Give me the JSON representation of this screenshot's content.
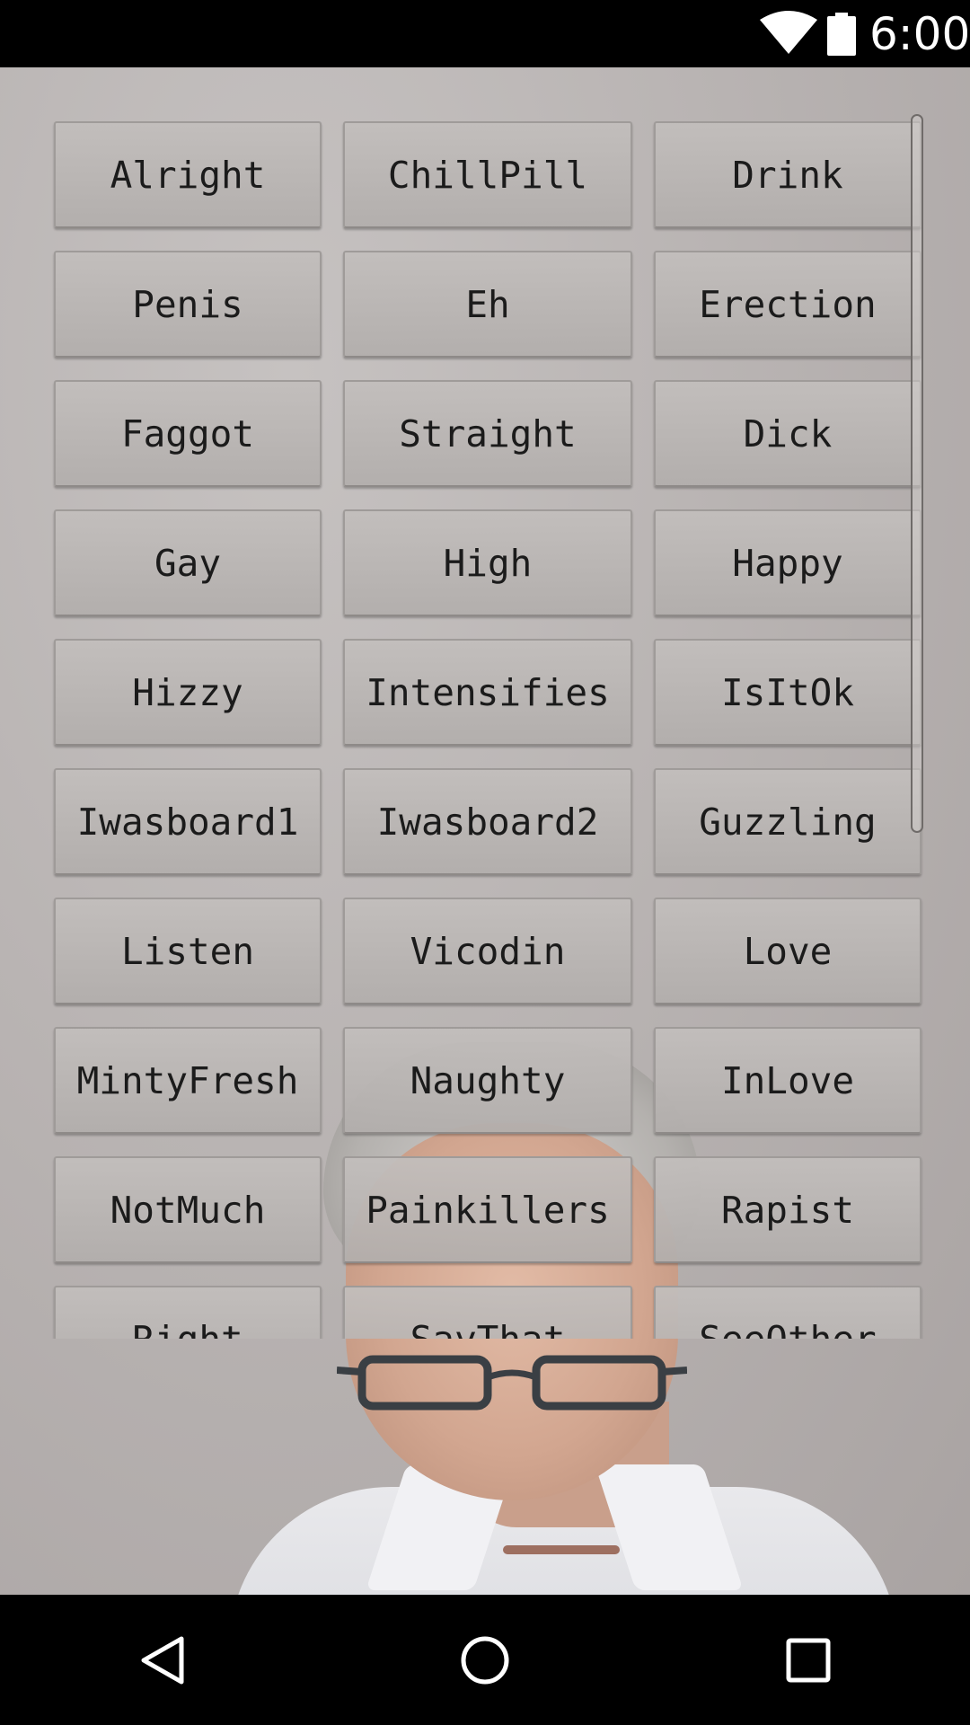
{
  "status_bar": {
    "time": "6:00",
    "icons": [
      "wifi-icon",
      "battery-icon"
    ]
  },
  "buttons": [
    {
      "label": "Alright"
    },
    {
      "label": "ChillPill"
    },
    {
      "label": "Drink"
    },
    {
      "label": "Penis"
    },
    {
      "label": "Eh"
    },
    {
      "label": "Erection"
    },
    {
      "label": "Faggot"
    },
    {
      "label": "Straight"
    },
    {
      "label": "Dick"
    },
    {
      "label": "Gay"
    },
    {
      "label": "High"
    },
    {
      "label": "Happy"
    },
    {
      "label": "Hizzy"
    },
    {
      "label": "Intensifies"
    },
    {
      "label": "IsItOk"
    },
    {
      "label": "Iwasboard1"
    },
    {
      "label": "Iwasboard2"
    },
    {
      "label": "Guzzling"
    },
    {
      "label": "Listen"
    },
    {
      "label": "Vicodin"
    },
    {
      "label": "Love"
    },
    {
      "label": "MintyFresh"
    },
    {
      "label": "Naughty"
    },
    {
      "label": "InLove"
    },
    {
      "label": "NotMuch"
    },
    {
      "label": "Painkillers"
    },
    {
      "label": "Rapist"
    },
    {
      "label": "Right"
    },
    {
      "label": "SayThat"
    },
    {
      "label": "SeeOther"
    }
  ],
  "nav_bar": {
    "icons": [
      "back-icon",
      "home-icon",
      "recents-icon"
    ]
  }
}
